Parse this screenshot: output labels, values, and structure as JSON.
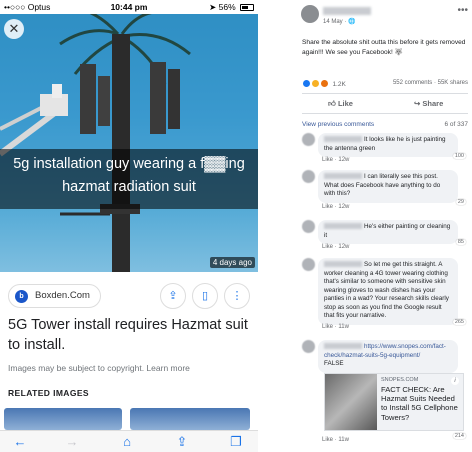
{
  "phone": {
    "status": {
      "carrier": "••○○○ Optus",
      "time": "10:44 pm",
      "battery": "56%"
    },
    "image": {
      "caption_line1": "5g installation guy wearing a f▓▓ing",
      "caption_line2": "hazmat radiation suit",
      "age": "4 days ago"
    },
    "source": "Boxden.Com",
    "title": "5G Tower install requires Hazmat suit to install.",
    "copyright": "Images may be subject to copyright. Learn more",
    "related_heading": "RELATED IMAGES"
  },
  "facebook": {
    "post": {
      "date": "14 May · 🌐",
      "text": "Share the absolute shit outta this before it gets removed again!!! We see you Facebook! 🐺",
      "reaction_count": "1.2K",
      "stats": "552 comments · 55K shares",
      "like_label": "Like",
      "share_label": "Share"
    },
    "view_previous": "View previous comments",
    "comment_count": "6 of 337",
    "comments": [
      {
        "text": "It looks like he is just painting the antenna green",
        "like": "Like",
        "age": "12w",
        "reactions": "100"
      },
      {
        "text": "I can literally see this post. What does Facebook have anything to do with this?",
        "like": "Like",
        "age": "12w",
        "reactions": "29"
      },
      {
        "text": "He's either painting or cleaning it",
        "like": "Like",
        "age": "12w",
        "reactions": "85"
      },
      {
        "text": "So let me get this straight. A worker cleaning a 4G tower wearing clothing that's similar to someone with sensitive skin wearing gloves to wash dishes has your panties in a wad? Your research skills clearly stop as soon as you find the Google result that fits your narrative.",
        "like": "Like",
        "age": "11w",
        "reactions": "265"
      },
      {
        "text": "https://www.snopes.com/fact-check/hazmat-suits-5g-equipment/",
        "text2": "FALSE",
        "like": "Like",
        "age": "11w",
        "reactions": "214"
      }
    ],
    "link_card": {
      "domain": "SNOPES.COM",
      "title": "FACT CHECK: Are Hazmat Suits Needed to Install 5G Cellphone Towers?"
    }
  },
  "colors": {
    "fb_link": "#385898",
    "ios_blue": "#1a73e8",
    "sky": "#3a99ce"
  }
}
